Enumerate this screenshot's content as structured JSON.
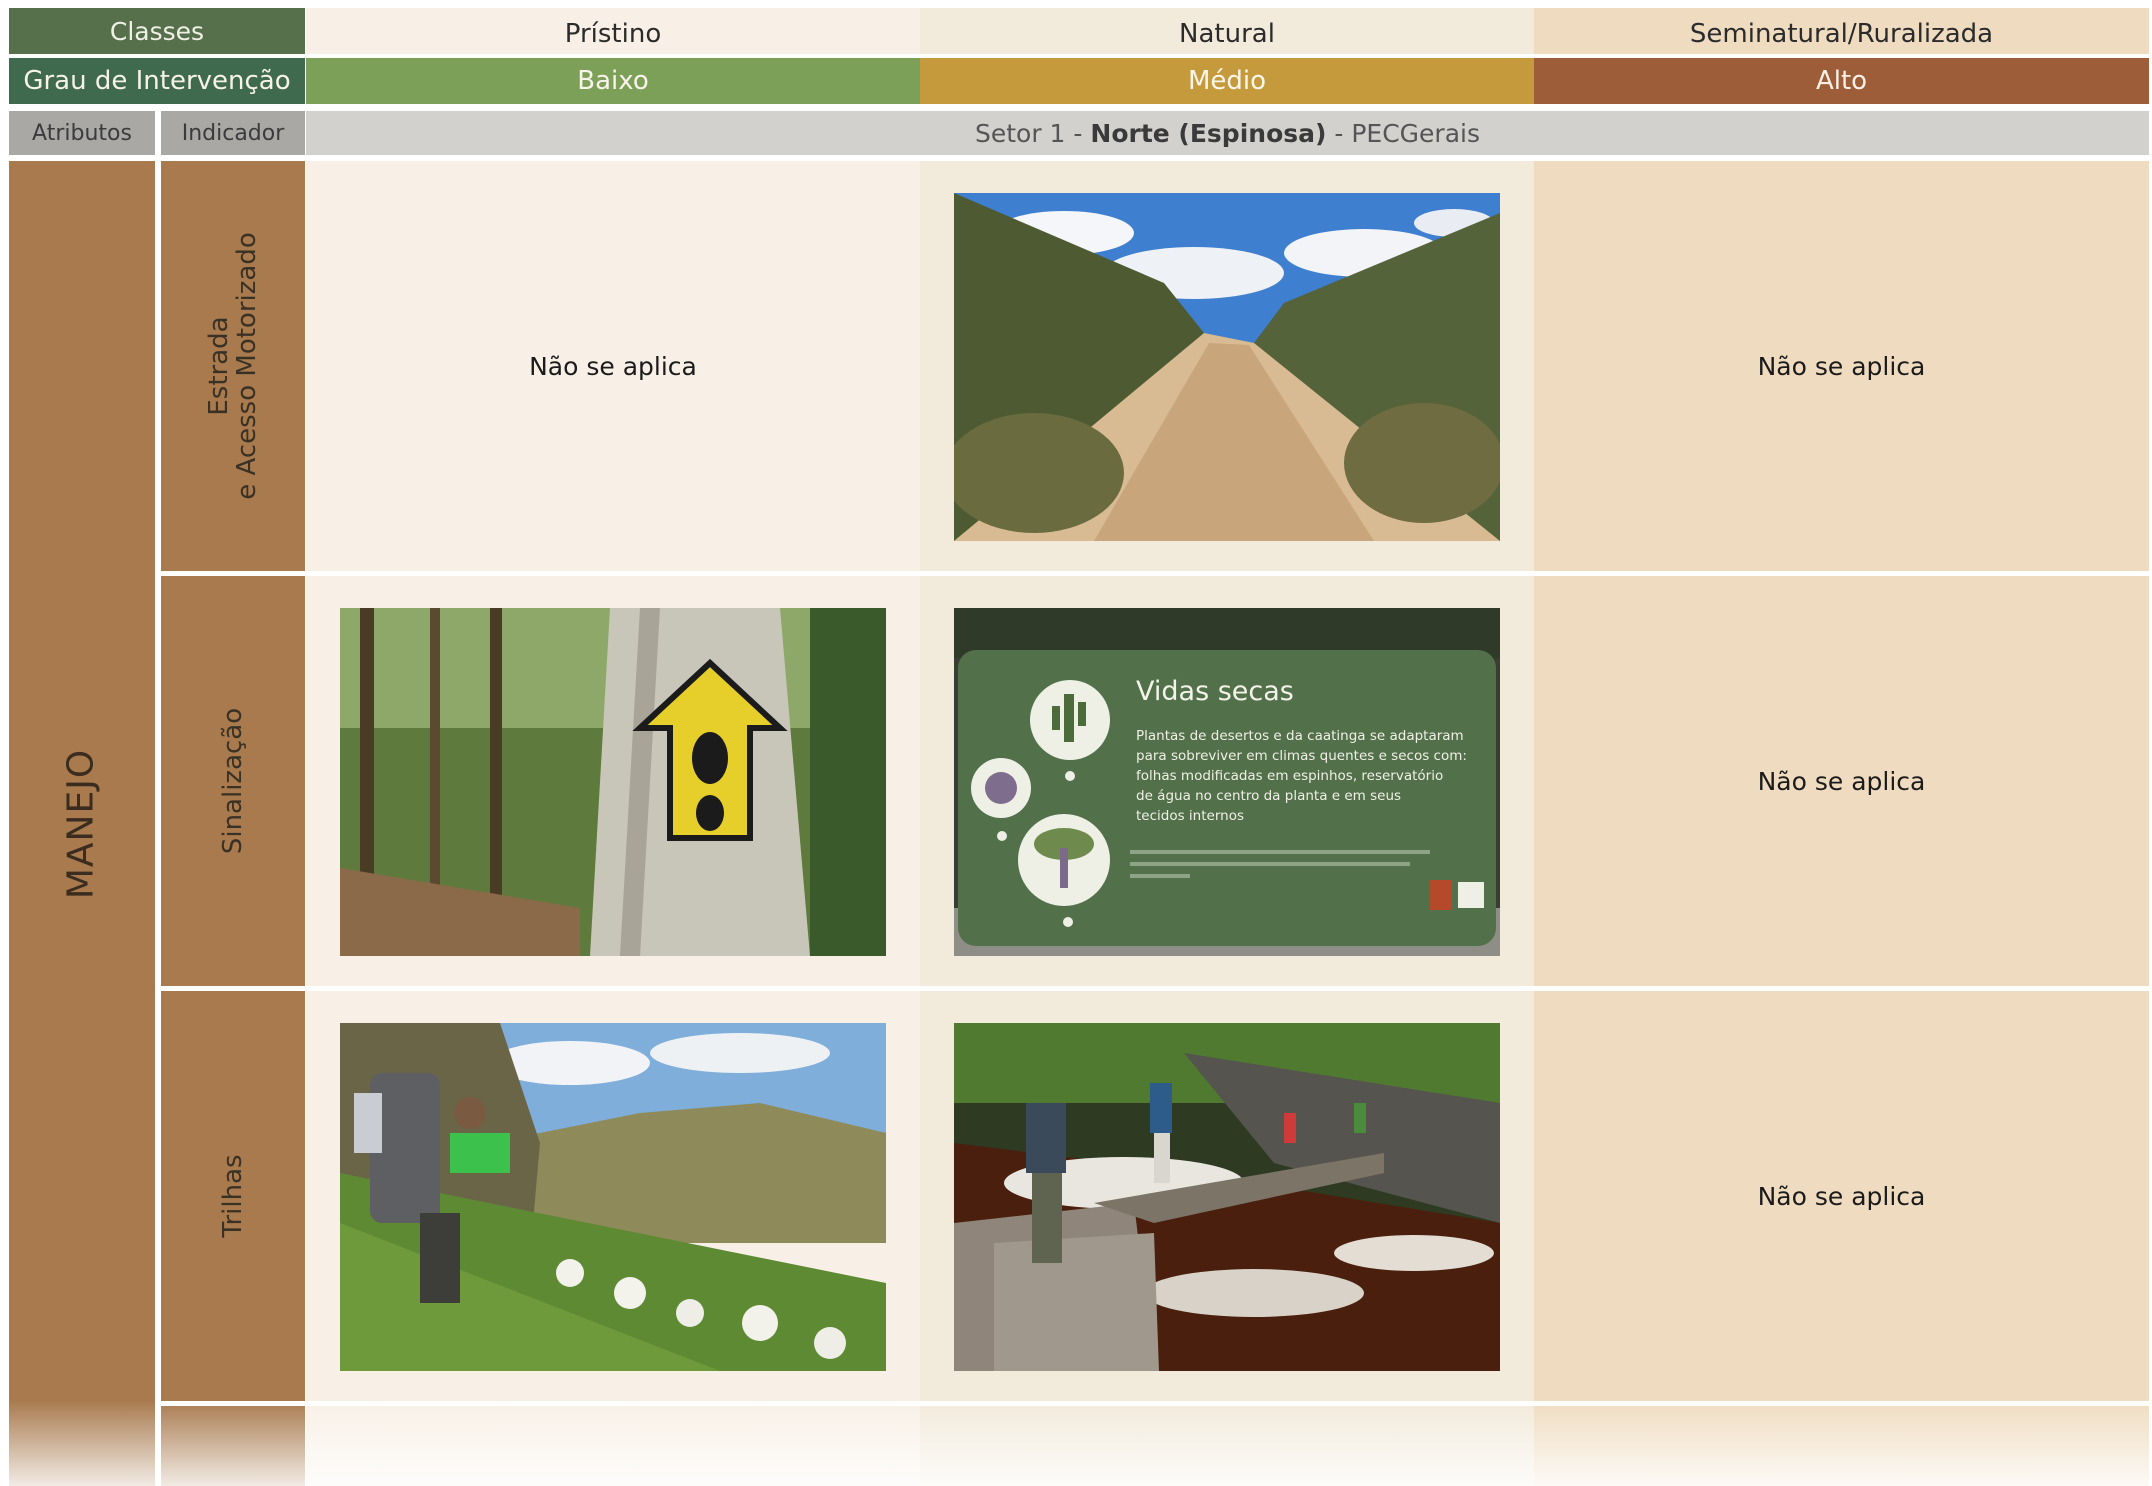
{
  "header": {
    "classes_label": "Classes",
    "grau_label": "Grau de Intervenção",
    "atributos_label": "Atributos",
    "indicador_label": "Indicador",
    "classes": [
      "Prístino",
      "Natural",
      "Seminatural/Ruralizada"
    ],
    "graus": [
      "Baixo",
      "Médio",
      "Alto"
    ],
    "sector": {
      "prefix": "Setor 1 - ",
      "bold": "Norte (Espinosa)",
      "suffix": " - PECGerais"
    }
  },
  "attribute": "MANEJO",
  "rows": [
    {
      "indicator_line1": "Estrada",
      "indicator_line2": "e Acesso Motorizado",
      "pristino": "Não se aplica",
      "semi": "Não se aplica"
    },
    {
      "indicator": "Sinalização",
      "semi": "Não se aplica"
    },
    {
      "indicator": "Trilhas",
      "semi": "Não se aplica"
    }
  ],
  "sign": {
    "title": "Vidas secas",
    "lines": [
      "Plantas de desertos e da caatinga se adaptaram",
      "para sobreviver em climas quentes e secos com:",
      "folhas modificadas em espinhos, reservatório",
      "de água no centro da planta e em seus",
      "tecidos internos"
    ]
  },
  "colors": {
    "classes_label": "#55704a",
    "grau_label": "#3f6a4d",
    "baixo": "#7ca057",
    "medio": "#c59a3d",
    "alto": "#9c5d38",
    "brown": "#a87a4e",
    "pristino_bg": "#f8f0e6",
    "natural_bg": "#f2eadb",
    "semi_bg": "#efdcc0"
  }
}
